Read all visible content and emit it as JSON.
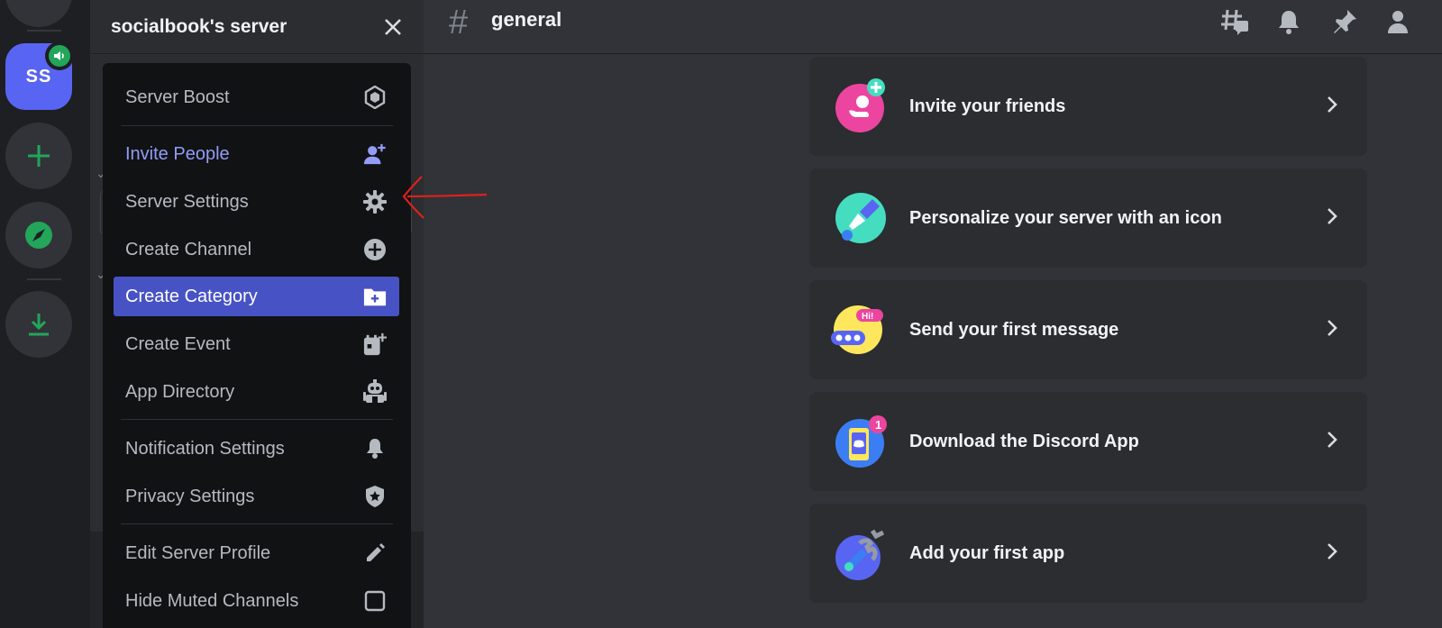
{
  "server": {
    "name": "socialbook's server",
    "short": "SS"
  },
  "channel": {
    "name": "general"
  },
  "menu": {
    "items": [
      {
        "label": "Server Boost",
        "icon": "boost-icon"
      },
      {
        "label": "Invite People",
        "icon": "add-person-icon"
      },
      {
        "label": "Server Settings",
        "icon": "gear-icon"
      },
      {
        "label": "Create Channel",
        "icon": "plus-circle-icon"
      },
      {
        "label": "Create Category",
        "icon": "folder-plus-icon"
      },
      {
        "label": "Create Event",
        "icon": "calendar-plus-icon"
      },
      {
        "label": "App Directory",
        "icon": "robot-icon"
      },
      {
        "label": "Notification Settings",
        "icon": "bell-icon"
      },
      {
        "label": "Privacy Settings",
        "icon": "shield-star-icon"
      },
      {
        "label": "Edit Server Profile",
        "icon": "pencil-icon"
      },
      {
        "label": "Hide Muted Channels",
        "icon": "checkbox-icon"
      }
    ]
  },
  "cards": [
    {
      "label": "Invite your friends",
      "icon": "invite-friends-icon"
    },
    {
      "label": "Personalize your server with an icon",
      "icon": "paintbrush-icon"
    },
    {
      "label": "Send your first message",
      "icon": "chat-bubble-icon"
    },
    {
      "label": "Download the Discord App",
      "icon": "phone-icon"
    },
    {
      "label": "Add your first app",
      "icon": "wrench-icon"
    }
  ],
  "colors": {
    "blurple": "#5865f2",
    "active_bg": "#4752c4",
    "accent_text": "#949cf7",
    "green": "#23a55a",
    "annotation": "#e0201b"
  }
}
